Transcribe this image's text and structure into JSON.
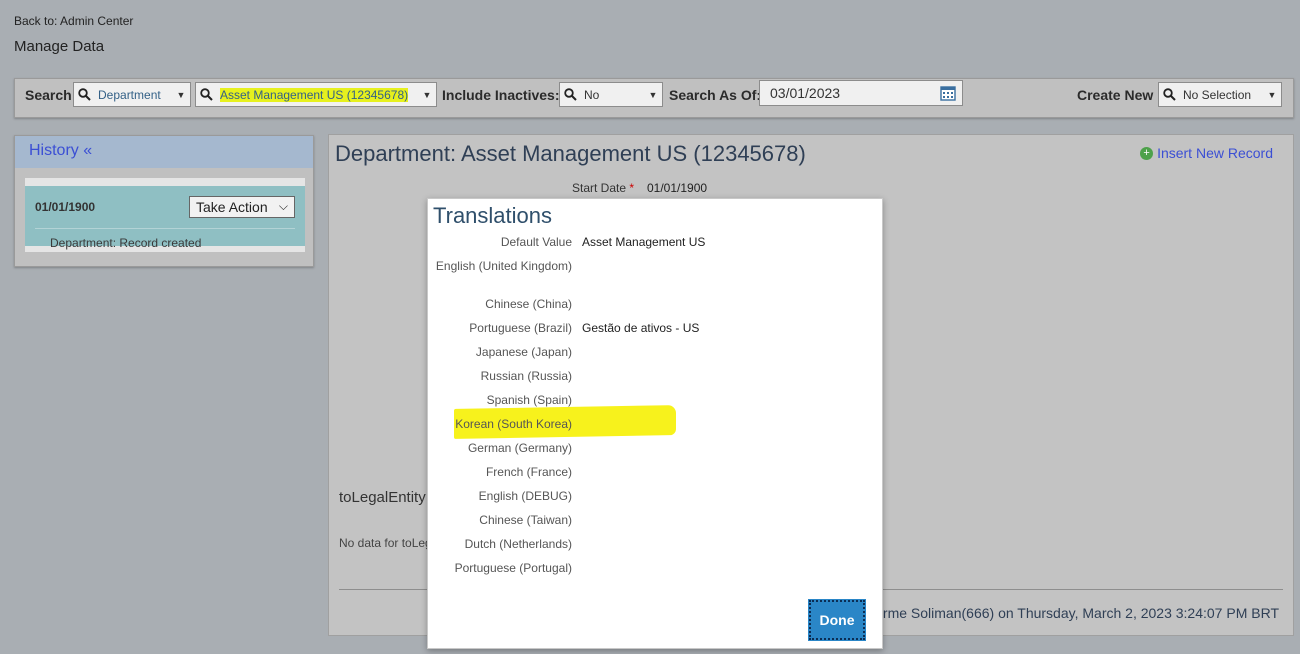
{
  "header": {
    "back_link": "Back to: Admin Center",
    "page_title": "Manage Data"
  },
  "searchbar": {
    "search_label": "Search",
    "object_type": "Department",
    "object_value": "Asset Management US (12345678)",
    "include_inactives_label": "Include Inactives:",
    "include_inactives_value": "No",
    "search_as_of_label": "Search As Of:",
    "search_as_of_value": "03/01/2023",
    "create_new_label": "Create New",
    "create_new_value": "No Selection"
  },
  "history": {
    "title": "History «",
    "record_date": "01/01/1900",
    "take_action_label": "Take Action",
    "record_text": "Department: Record created"
  },
  "main": {
    "title": "Department: Asset Management US (12345678)",
    "insert_link": "Insert New Record",
    "start_date_label": "Start Date",
    "required_mark": "*",
    "start_date_value": "01/01/1900",
    "to_legal_entity_label": "toLegalEntity",
    "no_data_text": "No data for toLeg",
    "footer_text": "erme Soliman(666) on Thursday, March 2, 2023 3:24:07 PM BRT"
  },
  "translations_dialog": {
    "title": "Translations",
    "rows": [
      {
        "label": "Default Value",
        "value": "Asset Management US"
      },
      {
        "label": "English (United Kingdom)",
        "value": ""
      },
      {
        "label": "Chinese (China)",
        "value": ""
      },
      {
        "label": "Portuguese (Brazil)",
        "value": "Gestão de ativos - US"
      },
      {
        "label": "Japanese (Japan)",
        "value": ""
      },
      {
        "label": "Russian (Russia)",
        "value": ""
      },
      {
        "label": "Spanish (Spain)",
        "value": ""
      },
      {
        "label": "Korean (South Korea)",
        "value": ""
      },
      {
        "label": "German (Germany)",
        "value": ""
      },
      {
        "label": "French (France)",
        "value": ""
      },
      {
        "label": "English (DEBUG)",
        "value": ""
      },
      {
        "label": "Chinese (Taiwan)",
        "value": ""
      },
      {
        "label": "Dutch (Netherlands)",
        "value": ""
      },
      {
        "label": "Portuguese (Portugal)",
        "value": ""
      }
    ],
    "done_label": "Done"
  },
  "colors": {
    "highlight": "#e6f01e",
    "link": "#3b4fd4",
    "done_button": "#2a86c7"
  }
}
